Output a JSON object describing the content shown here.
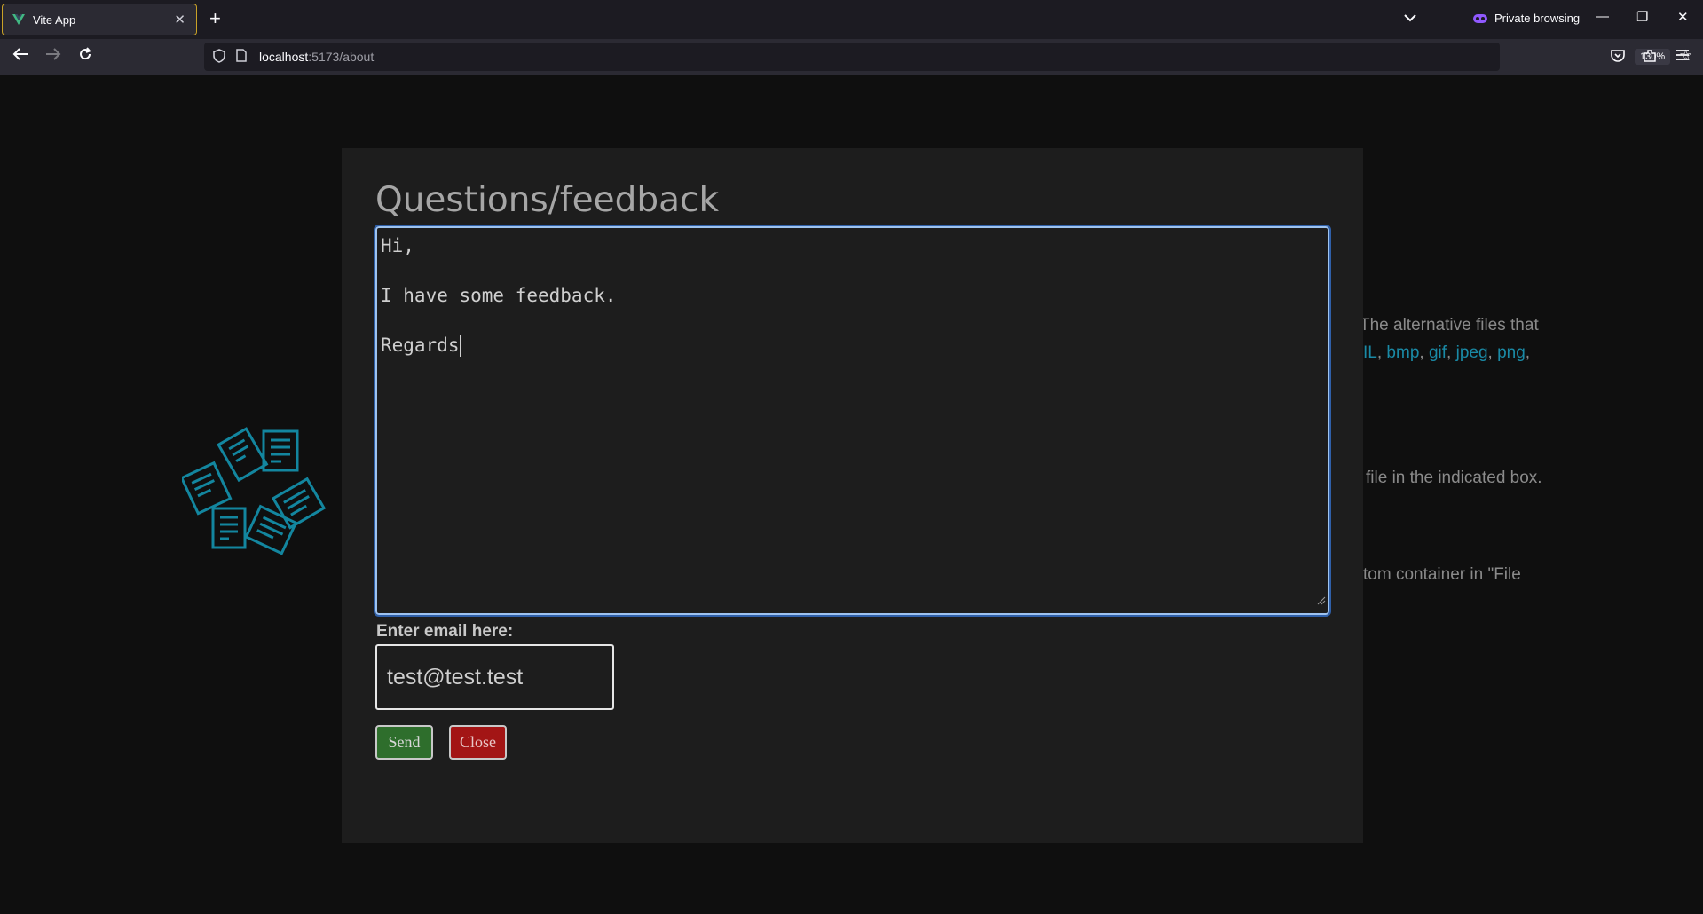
{
  "browser": {
    "tab_title": "Vite App",
    "tab_close": "✕",
    "new_tab": "+",
    "private_label": "Private browsing",
    "window_controls": {
      "minimize": "—",
      "restore": "❐",
      "close": "✕"
    },
    "url_host": "localhost",
    "url_path": ":5173/about",
    "zoom": "130%"
  },
  "page": {
    "bg_line1": "The alternative files that",
    "bg_links": [
      "IL",
      "bmp",
      "gif",
      "jpeg",
      "png"
    ],
    "bg_line3": "file in the indicated box.",
    "bg_line4": "tom container in \"File"
  },
  "modal": {
    "title": "Questions/feedback",
    "feedback_lines": [
      "Hi,",
      "",
      "I have some feedback.",
      "",
      "Regards"
    ],
    "email_label": "Enter email here:",
    "email_value": "test@test.test",
    "send_label": "Send",
    "close_label": "Close"
  },
  "colors": {
    "accent_link": "#1a8aa6",
    "send_button": "#2e6e2c",
    "close_button": "#a31515",
    "focus_ring": "#9ec3f0"
  }
}
